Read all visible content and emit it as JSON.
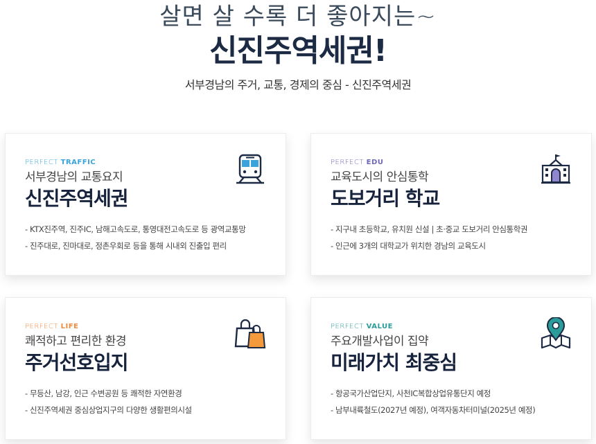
{
  "hero": {
    "subtitle": "살면 살 수록 더 좋아지는~",
    "title": "신진주역세권!",
    "description": "서부경남의 주거, 교통, 경제의 중심 - 신진주역세권"
  },
  "cards": [
    {
      "kicker_prefix": "PERFECT",
      "kicker_key": "TRAFFIC",
      "subtitle": "서부경남의 교통요지",
      "title": "신진주역세권",
      "icon": "train-icon",
      "items": [
        "- KTX진주역, 진주IC, 남해고속도로, 통영대전고속도로 등 광역교통망",
        "- 진주대로, 진마대로, 정촌우회로 등을 통해 시내외 진출입 편리"
      ]
    },
    {
      "kicker_prefix": "PERFECT",
      "kicker_key": "EDU",
      "subtitle": "교육도시의 안심통학",
      "title": "도보거리 학교",
      "icon": "school-icon",
      "items": [
        "- 지구내 초등학교, 유치원 신설 | 초·중교 도보거리 안심통학권",
        "- 인근에 3개의 대학교가 위치한 경남의 교육도시"
      ]
    },
    {
      "kicker_prefix": "PERFECT",
      "kicker_key": "LIFE",
      "subtitle": "쾌적하고 편리한 환경",
      "title": "주거선호입지",
      "icon": "shopping-bags-icon",
      "items": [
        "- 무등산, 남강, 인근 수변공원 등 쾌적한 자연환경",
        "- 신진주역세권 중심상업지구의 다양한 생활편의시설"
      ]
    },
    {
      "kicker_prefix": "PERFECT",
      "kicker_key": "VALUE",
      "subtitle": "주요개발사업이 집약",
      "title": "미래가치 최중심",
      "icon": "map-pin-icon",
      "items": [
        "- 항공국가산업단지, 사천IC복합상업유통단지 예정",
        "- 남부내륙철도(2027년 예정), 여객자동차터미널(2025년 예정)"
      ]
    }
  ],
  "colors": {
    "navy": "#1c2a44",
    "traffic": "#3aa3dc",
    "edu": "#6e67b6",
    "life": "#ef8a3e",
    "value": "#2a9d9a"
  }
}
